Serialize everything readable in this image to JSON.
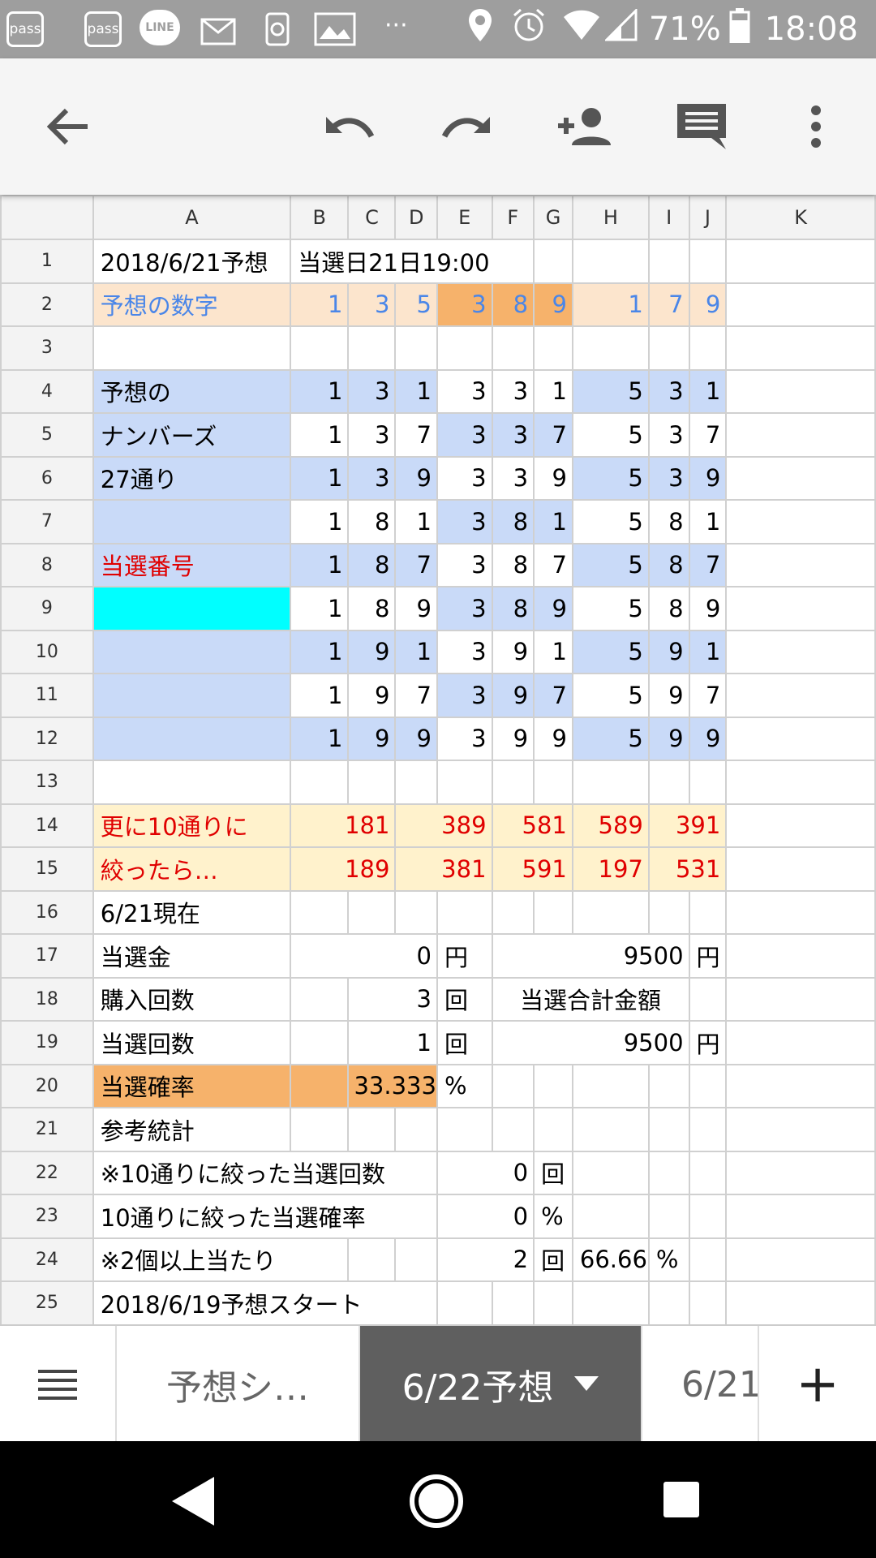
{
  "status_bar": {
    "icons": [
      "pass-icon",
      "pass-icon",
      "line-icon",
      "mail-icon",
      "sync-icon",
      "image-icon",
      "more-dots-icon"
    ],
    "pass_label_1": "pass",
    "pass_label_2": "pass",
    "line_label": "LINE",
    "dots": "···",
    "battery": "71%",
    "time": "18:08"
  },
  "toolbar": {
    "back": "back-arrow-icon",
    "undo": "undo-icon",
    "redo": "redo-icon",
    "share": "add-person-icon",
    "comments": "comment-icon",
    "more": "more-vert-icon"
  },
  "columns": [
    "A",
    "B",
    "C",
    "D",
    "E",
    "F",
    "G",
    "H",
    "I",
    "J",
    "K"
  ],
  "rows": {
    "r1": {
      "num": "1",
      "a": "2018/6/21予想",
      "merged": "当選日21日19:00"
    },
    "r2": {
      "num": "2",
      "a": "予想の数字",
      "b": "1",
      "c": "3",
      "d": "5",
      "e": "3",
      "f": "8",
      "g": "9",
      "h": "1",
      "i": "7",
      "j": "9"
    },
    "r3": {
      "num": "3"
    },
    "r4": {
      "num": "4",
      "a": "予想の",
      "b": "1",
      "c": "3",
      "d": "1",
      "e": "3",
      "f": "3",
      "g": "1",
      "h": "5",
      "i": "3",
      "j": "1"
    },
    "r5": {
      "num": "5",
      "a": "ナンバーズ",
      "b": "1",
      "c": "3",
      "d": "7",
      "e": "3",
      "f": "3",
      "g": "7",
      "h": "5",
      "i": "3",
      "j": "7"
    },
    "r6": {
      "num": "6",
      "a": "27通り",
      "b": "1",
      "c": "3",
      "d": "9",
      "e": "3",
      "f": "3",
      "g": "9",
      "h": "5",
      "i": "3",
      "j": "9"
    },
    "r7": {
      "num": "7",
      "a": "",
      "b": "1",
      "c": "8",
      "d": "1",
      "e": "3",
      "f": "8",
      "g": "1",
      "h": "5",
      "i": "8",
      "j": "1"
    },
    "r8": {
      "num": "8",
      "a": "当選番号",
      "b": "1",
      "c": "8",
      "d": "7",
      "e": "3",
      "f": "8",
      "g": "7",
      "h": "5",
      "i": "8",
      "j": "7"
    },
    "r9": {
      "num": "9",
      "a": "",
      "b": "1",
      "c": "8",
      "d": "9",
      "e": "3",
      "f": "8",
      "g": "9",
      "h": "5",
      "i": "8",
      "j": "9"
    },
    "r10": {
      "num": "10",
      "a": "",
      "b": "1",
      "c": "9",
      "d": "1",
      "e": "3",
      "f": "9",
      "g": "1",
      "h": "5",
      "i": "9",
      "j": "1"
    },
    "r11": {
      "num": "11",
      "a": "",
      "b": "1",
      "c": "9",
      "d": "7",
      "e": "3",
      "f": "9",
      "g": "7",
      "h": "5",
      "i": "9",
      "j": "7"
    },
    "r12": {
      "num": "12",
      "a": "",
      "b": "1",
      "c": "9",
      "d": "9",
      "e": "3",
      "f": "9",
      "g": "9",
      "h": "5",
      "i": "9",
      "j": "9"
    },
    "r13": {
      "num": "13"
    },
    "r14": {
      "num": "14",
      "a": "更に10通りに",
      "bc": "181",
      "de": "389",
      "f": "581",
      "gh": "589",
      "ij": "391"
    },
    "r15": {
      "num": "15",
      "a": "絞ったら…",
      "bc": "189",
      "de": "381",
      "f": "591",
      "gh": "197",
      "ij": "531"
    },
    "r16": {
      "num": "16",
      "a": "6/21現在"
    },
    "r17": {
      "num": "17",
      "a": "当選金",
      "val1": "0",
      "unit1": "円",
      "val2": "9500",
      "unit2": "円"
    },
    "r18": {
      "num": "18",
      "a": "購入回数",
      "val1": "3",
      "unit1": "回",
      "label2": "当選合計金額"
    },
    "r19": {
      "num": "19",
      "a": "当選回数",
      "val1": "1",
      "unit1": "回",
      "val2": "9500",
      "unit2": "円"
    },
    "r20": {
      "num": "20",
      "a": "当選確率",
      "val1": "33.333",
      "unit1": "%"
    },
    "r21": {
      "num": "21",
      "a": "参考統計"
    },
    "r22": {
      "num": "22",
      "a": "※10通りに絞った当選回数",
      "val": "0",
      "unit": "回"
    },
    "r23": {
      "num": "23",
      "a": "10通りに絞った当選確率",
      "val": "0",
      "unit": "%"
    },
    "r24": {
      "num": "24",
      "a": "※2個以上当たり",
      "val": "2",
      "unit": "回",
      "pct": "66.66",
      "pct_unit": "%"
    },
    "r25": {
      "num": "25",
      "a": "2018/6/19予想スタート"
    }
  },
  "tabs": {
    "menu": "menu-icon",
    "tab1": "予想シ…",
    "tab2": "6/22予想",
    "tab3": "6/21",
    "add": "+"
  },
  "colors": {
    "blue_fill": "#c9daf8",
    "peach_fill": "#fce5cd",
    "orange_fill": "#f6b26b",
    "cream_fill": "#fff2cc",
    "cyan_fill": "#00ffff",
    "blue_text": "#4a86e8",
    "red_text": "#e00000",
    "active_tab": "#5f5f5f"
  }
}
